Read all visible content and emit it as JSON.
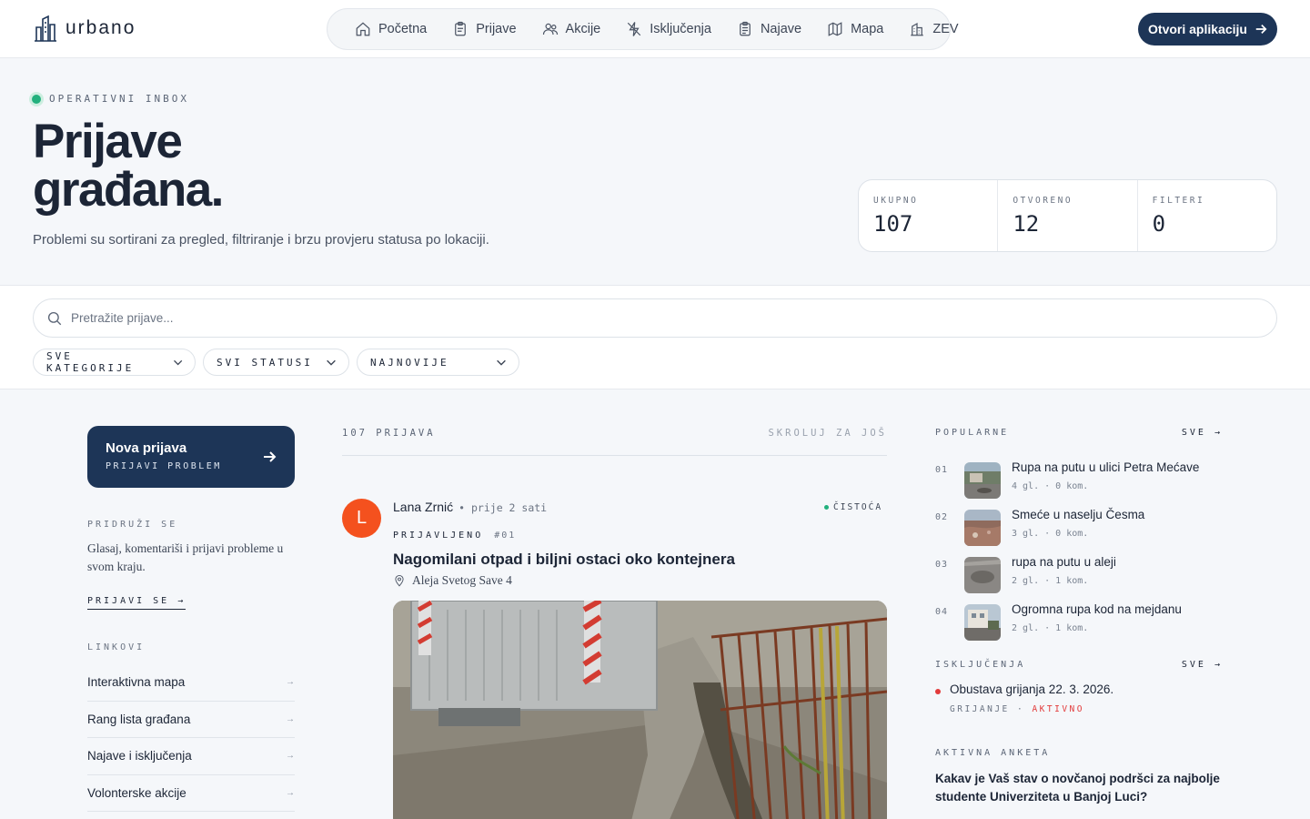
{
  "brand": {
    "name": "urbano"
  },
  "nav": [
    {
      "label": "Početna",
      "icon": "home-icon"
    },
    {
      "label": "Prijave",
      "icon": "clipboard-icon"
    },
    {
      "label": "Akcije",
      "icon": "users-icon"
    },
    {
      "label": "Isključenja",
      "icon": "power-off-icon"
    },
    {
      "label": "Najave",
      "icon": "clipboard-list-icon"
    },
    {
      "label": "Mapa",
      "icon": "map-icon"
    },
    {
      "label": "ZEV",
      "icon": "building-icon"
    }
  ],
  "header": {
    "open_app": "Otvori aplikaciju"
  },
  "hero": {
    "eyebrow": "OPERATIVNI INBOX",
    "title_line1": "Prijave",
    "title_line2": "građana.",
    "subtitle": "Problemi su sortirani za pregled, filtriranje i brzu provjeru statusa po lokaciji."
  },
  "stats": [
    {
      "label": "UKUPNO",
      "value": "107"
    },
    {
      "label": "OTVORENO",
      "value": "12"
    },
    {
      "label": "FILTERI",
      "value": "0"
    }
  ],
  "search": {
    "placeholder": "Pretražite prijave..."
  },
  "filters": [
    {
      "label": "SVE KATEGORIJE"
    },
    {
      "label": "SVI STATUSI"
    },
    {
      "label": "NAJNOVIJE"
    }
  ],
  "sidebar": {
    "new_report_title": "Nova prijava",
    "new_report_sub": "PRIJAVI PROBLEM",
    "join_label": "PRIDRUŽI SE",
    "join_text": "Glasaj, komentariši i prijavi probleme u svom kraju.",
    "join_link": "PRIJAVI SE →",
    "links_label": "LINKOVI",
    "links": [
      {
        "label": "Interaktivna mapa"
      },
      {
        "label": "Rang lista građana"
      },
      {
        "label": "Najave i isključenja"
      },
      {
        "label": "Volonterske akcije"
      }
    ],
    "link_arrow": "→"
  },
  "feed": {
    "count": "107 PRIJAVA",
    "scroll_hint": "SKROLUJ ZA JOŠ",
    "post": {
      "avatar": "L",
      "author": "Lana Zrnić",
      "time": "• prije 2 sati",
      "category": "ČISTOĆA",
      "status": "PRIJAVLJENO",
      "number": "#01",
      "title": "Nagomilani otpad i biljni ostaci oko kontejnera",
      "location": "Aleja Svetog Save 4"
    }
  },
  "popular": {
    "label": "POPULARNE",
    "all": "SVE →",
    "items": [
      {
        "num": "01",
        "title": "Rupa na putu u ulici Petra Mećave",
        "meta": "4 gl.  ·  0 kom."
      },
      {
        "num": "02",
        "title": "Smeće u naselju Česma",
        "meta": "3 gl.  ·  0 kom."
      },
      {
        "num": "03",
        "title": "rupa na putu u aleji",
        "meta": "2 gl.  ·  1 kom."
      },
      {
        "num": "04",
        "title": "Ogromna rupa kod na mejdanu",
        "meta": "2 gl.  ·  1 kom."
      }
    ]
  },
  "outages": {
    "label": "ISKLJUČENJA",
    "all": "SVE →",
    "item_title": "Obustava grijanja 22. 3. 2026.",
    "item_type": "GRIJANJE",
    "item_sep": " · ",
    "item_status": "AKTIVNO"
  },
  "poll": {
    "label": "AKTIVNA ANKETA",
    "question": "Kakav je Vaš stav o novčanoj podršci za najbolje studente Univerziteta u Banjoj Luci?"
  },
  "colors": {
    "primary": "#1d3557",
    "accent_green": "#22b07d",
    "alert_red": "#e23a3a",
    "avatar": "#f4511e"
  }
}
